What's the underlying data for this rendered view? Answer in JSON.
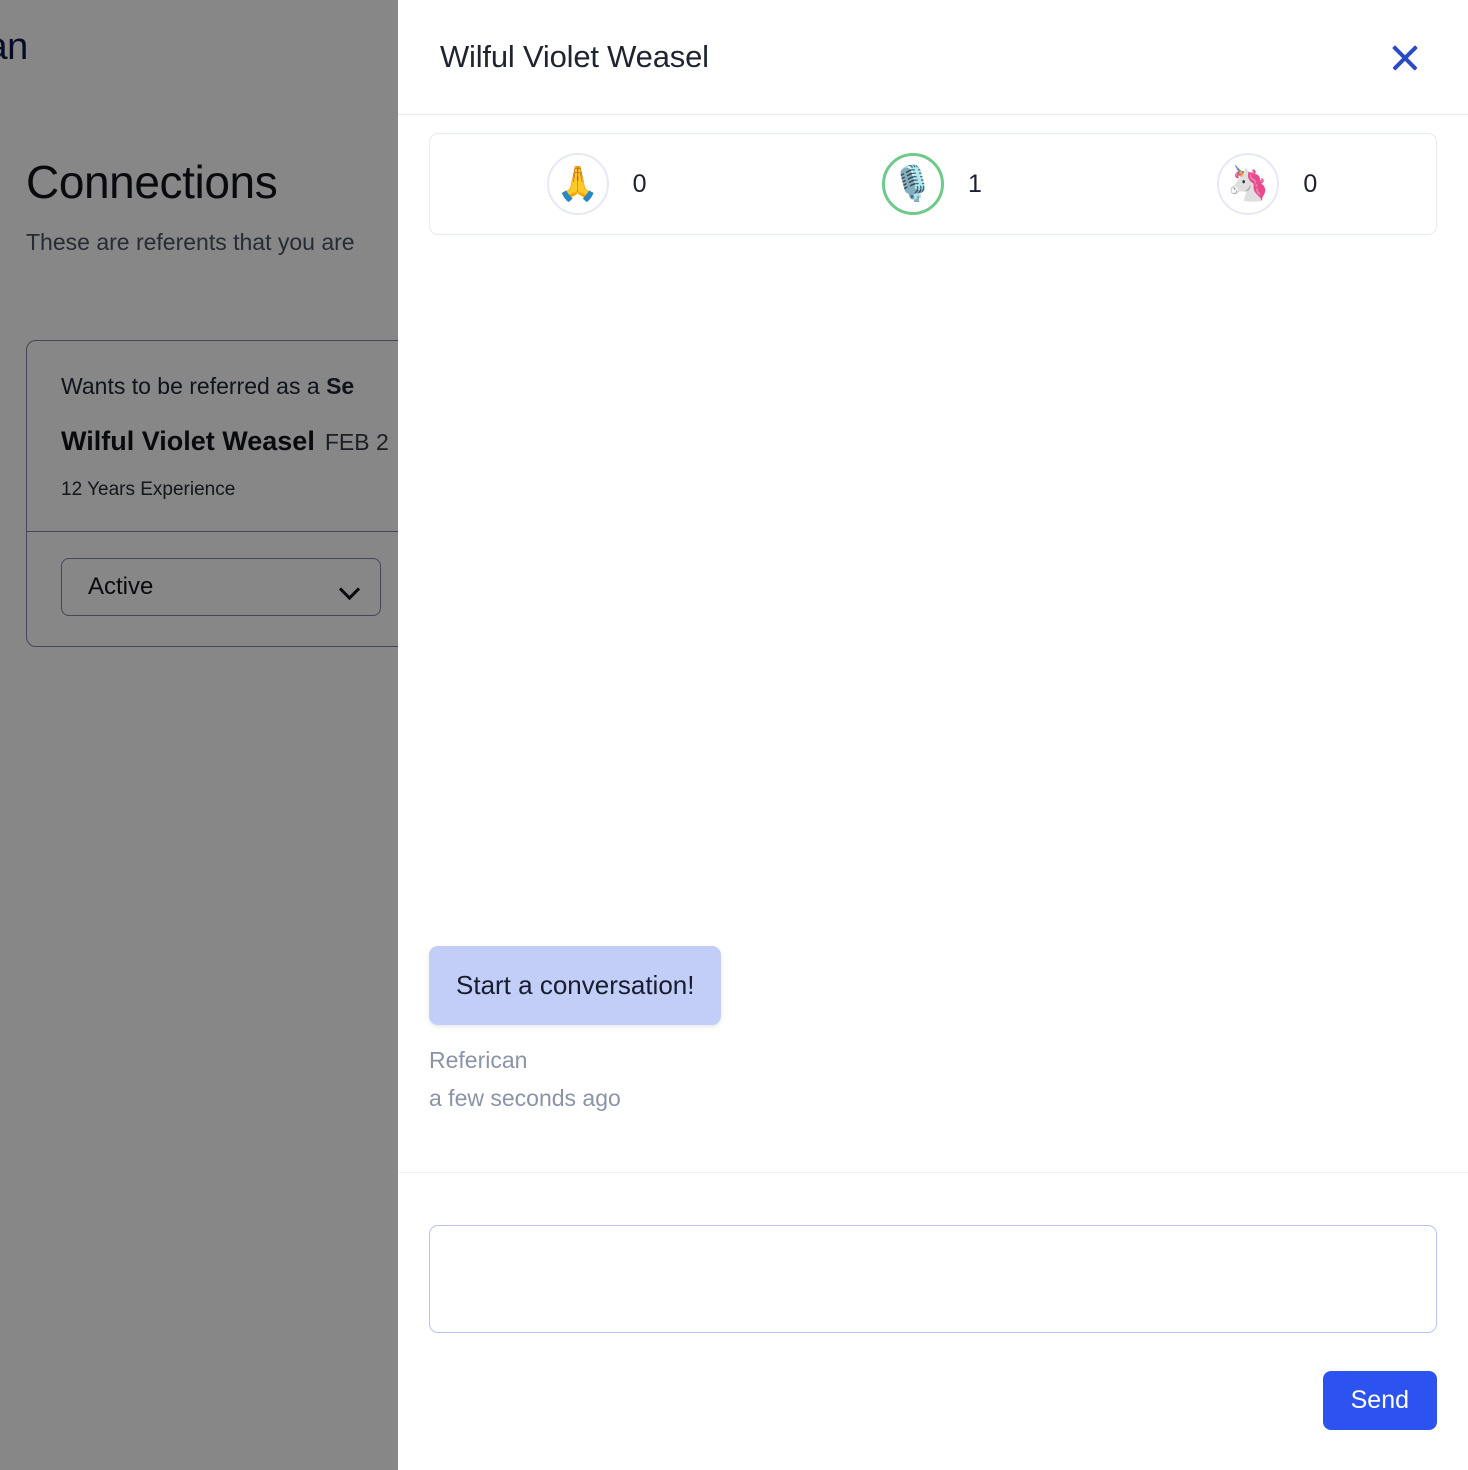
{
  "background": {
    "logo_text": "can",
    "page_title": "Connections",
    "page_subtitle": "These are referents that you are",
    "card": {
      "referred_prefix": "Wants to be referred as a ",
      "referred_role": "Se",
      "name": "Wilful Violet Weasel",
      "date": "FEB 2",
      "experience": "12 Years Experience",
      "status_value": "Active",
      "chevron_icon": "chevron-down-icon"
    }
  },
  "drawer": {
    "title": "Wilful Violet Weasel",
    "close_icon": "close-icon",
    "reactions": [
      {
        "icon": "praying-hands-icon",
        "emoji": "🙏",
        "count": "0",
        "selected": false
      },
      {
        "icon": "studio-microphone-icon",
        "emoji": "🎙️",
        "count": "1",
        "selected": true
      },
      {
        "icon": "unicorn-icon",
        "emoji": "🦄",
        "count": "0",
        "selected": false
      }
    ],
    "messages": [
      {
        "text": "Start a conversation!",
        "author": "Referican",
        "time": "a few seconds ago"
      }
    ],
    "composer": {
      "value": "",
      "placeholder": "",
      "send_label": "Send"
    }
  },
  "colors": {
    "accent_blue": "#2c53ef",
    "close_blue": "#2a4bc4",
    "bubble": "#c2cdf8",
    "selected_ring": "#6fc98a",
    "muted_text": "#8b93a6",
    "input_border": "#b7c4f3"
  }
}
